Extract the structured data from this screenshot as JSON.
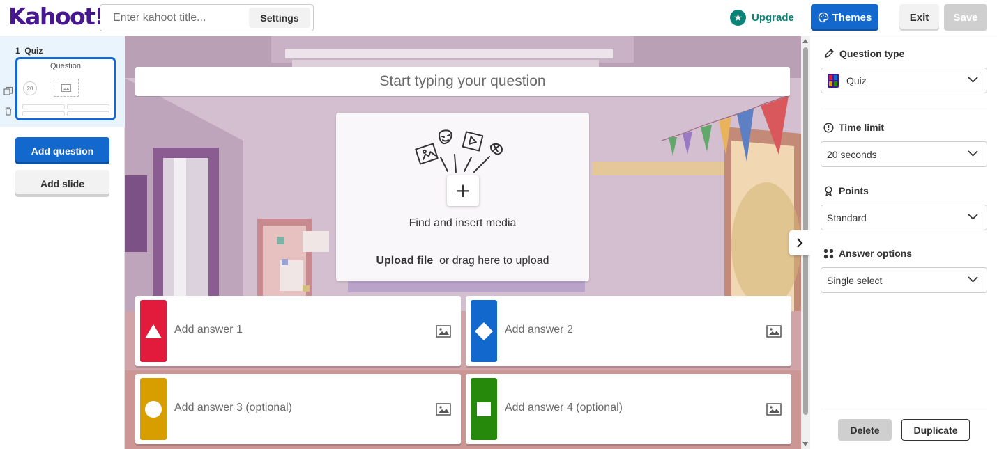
{
  "header": {
    "logo": "Kahoot!",
    "title_placeholder": "Enter kahoot title...",
    "settings_label": "Settings",
    "upgrade_label": "Upgrade",
    "themes_label": "Themes",
    "exit_label": "Exit",
    "save_label": "Save"
  },
  "sidebar": {
    "slide_number": "1",
    "slide_type": "Quiz",
    "thumb_title": "Question",
    "thumb_timer": "20",
    "add_question_label": "Add question",
    "add_slide_label": "Add slide"
  },
  "editor": {
    "question_placeholder": "Start typing your question",
    "media_title": "Find and insert media",
    "upload_link": "Upload file",
    "upload_suffix": "or drag here to upload",
    "answers": [
      {
        "label": "Add answer 1",
        "color": "#e21b3c",
        "shape": "triangle"
      },
      {
        "label": "Add answer 2",
        "color": "#1368ce",
        "shape": "diamond"
      },
      {
        "label": "Add answer 3 (optional)",
        "color": "#d89e00",
        "shape": "circle"
      },
      {
        "label": "Add answer 4 (optional)",
        "color": "#26890c",
        "shape": "square"
      }
    ]
  },
  "panel": {
    "question_type_label": "Question type",
    "question_type_value": "Quiz",
    "time_limit_label": "Time limit",
    "time_limit_value": "20 seconds",
    "points_label": "Points",
    "points_value": "Standard",
    "answer_options_label": "Answer options",
    "answer_options_value": "Single select",
    "delete_label": "Delete",
    "duplicate_label": "Duplicate"
  },
  "colors": {
    "brand_purple": "#46178f",
    "primary_blue": "#1368ce",
    "upgrade_teal": "#0b8379"
  }
}
